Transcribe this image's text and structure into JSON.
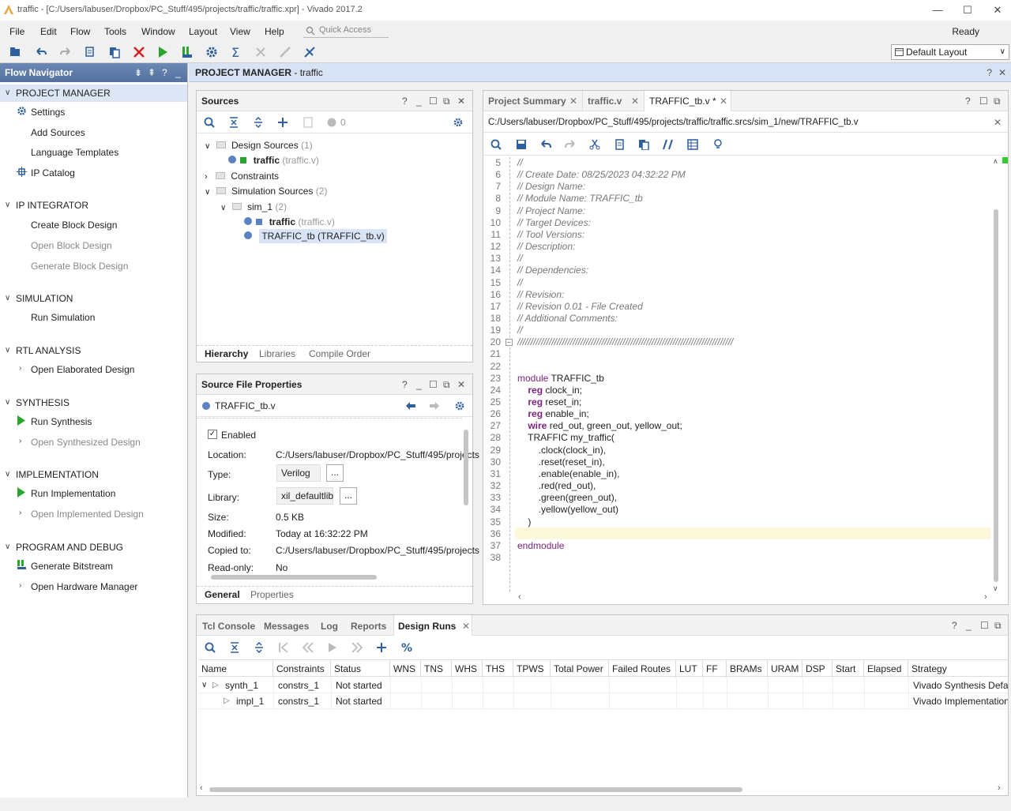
{
  "window": {
    "title": "traffic - [C:/Users/labuser/Dropbox/PC_Stuff/495/projects/traffic/traffic.xpr] - Vivado 2017.2",
    "status": "Ready"
  },
  "menu": {
    "items": [
      "File",
      "Edit",
      "Flow",
      "Tools",
      "Window",
      "Layout",
      "View",
      "Help"
    ],
    "quick_access_placeholder": "Quick Access"
  },
  "toolbar": {
    "layout_select": "Default Layout"
  },
  "flow_navigator": {
    "title": "Flow Navigator",
    "sections": [
      {
        "label": "PROJECT MANAGER",
        "items": [
          {
            "label": "Settings",
            "icon": "gear-icon"
          },
          {
            "label": "Add Sources"
          },
          {
            "label": "Language Templates"
          },
          {
            "label": "IP Catalog",
            "icon": "ip-catalog-icon"
          }
        ]
      },
      {
        "label": "IP INTEGRATOR",
        "items": [
          {
            "label": "Create Block Design"
          },
          {
            "label": "Open Block Design",
            "dim": true
          },
          {
            "label": "Generate Block Design",
            "dim": true
          }
        ]
      },
      {
        "label": "SIMULATION",
        "items": [
          {
            "label": "Run Simulation"
          }
        ]
      },
      {
        "label": "RTL ANALYSIS",
        "items": [
          {
            "label": "Open Elaborated Design"
          }
        ]
      },
      {
        "label": "SYNTHESIS",
        "items": [
          {
            "label": "Run Synthesis"
          },
          {
            "label": "Open Synthesized Design",
            "dim": true
          }
        ]
      },
      {
        "label": "IMPLEMENTATION",
        "items": [
          {
            "label": "Run Implementation"
          },
          {
            "label": "Open Implemented Design",
            "dim": true
          }
        ]
      },
      {
        "label": "PROGRAM AND DEBUG",
        "items": [
          {
            "label": "Generate Bitstream"
          },
          {
            "label": "Open Hardware Manager"
          }
        ]
      }
    ]
  },
  "project_manager": {
    "title": "PROJECT MANAGER",
    "project": "- traffic"
  },
  "sources": {
    "title": "Sources",
    "badge": "0",
    "tree": [
      {
        "label": "Design Sources",
        "count": "(1)"
      },
      {
        "label": "traffic",
        "extra": "(traffic.v)"
      },
      {
        "label": "Constraints"
      },
      {
        "label": "Simulation Sources",
        "count": "(2)"
      },
      {
        "label": "sim_1",
        "count": "(2)"
      },
      {
        "label": "traffic",
        "extra": "(traffic.v)"
      },
      {
        "label": "TRAFFIC_tb (TRAFFIC_tb.v)"
      }
    ],
    "tabs": [
      "Hierarchy",
      "Libraries",
      "Compile Order"
    ]
  },
  "file_props": {
    "title": "Source File Properties",
    "file": "TRAFFIC_tb.v",
    "enabled_label": "Enabled",
    "rows": [
      {
        "label": "Location:",
        "value": "C:/Users/labuser/Dropbox/PC_Stuff/495/projects"
      },
      {
        "label": "Type:",
        "value": "Verilog"
      },
      {
        "label": "Library:",
        "value": "xil_defaultlib"
      },
      {
        "label": "Size:",
        "value": "0.5 KB"
      },
      {
        "label": "Modified:",
        "value": "Today at 16:32:22 PM"
      },
      {
        "label": "Copied to:",
        "value": "C:/Users/labuser/Dropbox/PC_Stuff/495/projects"
      },
      {
        "label": "Read-only:",
        "value": "No"
      }
    ],
    "ellipsis": "...",
    "tabs": [
      "General",
      "Properties"
    ]
  },
  "editor": {
    "tabs": [
      "Project Summary",
      "traffic.v",
      "TRAFFIC_tb.v *"
    ],
    "path": "C:/Users/labuser/Dropbox/PC_Stuff/495/projects/traffic/traffic.srcs/sim_1/new/TRAFFIC_tb.v",
    "lines": [
      {
        "n": "5",
        "t": "//"
      },
      {
        "n": "6",
        "t": "// Create Date: 08/25/2023 04:32:22 PM"
      },
      {
        "n": "7",
        "t": "// Design Name:"
      },
      {
        "n": "8",
        "t": "// Module Name: TRAFFIC_tb"
      },
      {
        "n": "9",
        "t": "// Project Name:"
      },
      {
        "n": "10",
        "t": "// Target Devices:"
      },
      {
        "n": "11",
        "t": "// Tool Versions:"
      },
      {
        "n": "12",
        "t": "// Description:"
      },
      {
        "n": "13",
        "t": "//"
      },
      {
        "n": "14",
        "t": "// Dependencies:"
      },
      {
        "n": "15",
        "t": "//"
      },
      {
        "n": "16",
        "t": "// Revision:"
      },
      {
        "n": "17",
        "t": "// Revision 0.01 - File Created"
      },
      {
        "n": "18",
        "t": "// Additional Comments:"
      },
      {
        "n": "19",
        "t": "//"
      },
      {
        "n": "20",
        "t": "//////////////////////////////////////////////////////////////////////////////////"
      },
      {
        "n": "21",
        "t": ""
      },
      {
        "n": "22",
        "t": ""
      },
      {
        "n": "23",
        "t": "module TRAFFIC_tb"
      },
      {
        "n": "24",
        "t": "    reg clock_in;"
      },
      {
        "n": "25",
        "t": "    reg reset_in;"
      },
      {
        "n": "26",
        "t": "    reg enable_in;"
      },
      {
        "n": "27",
        "t": "    wire red_out, green_out, yellow_out;"
      },
      {
        "n": "28",
        "t": "    TRAFFIC my_traffic("
      },
      {
        "n": "29",
        "t": "        .clock(clock_in),"
      },
      {
        "n": "30",
        "t": "        .reset(reset_in),"
      },
      {
        "n": "31",
        "t": "        .enable(enable_in),"
      },
      {
        "n": "32",
        "t": "        .red(red_out),"
      },
      {
        "n": "33",
        "t": "        .green(green_out),"
      },
      {
        "n": "34",
        "t": "        .yellow(yellow_out)"
      },
      {
        "n": "35",
        "t": "    )"
      },
      {
        "n": "36",
        "t": ""
      },
      {
        "n": "37",
        "t": "endmodule"
      },
      {
        "n": "38",
        "t": ""
      }
    ]
  },
  "bottom": {
    "tabs": [
      "Tcl Console",
      "Messages",
      "Log",
      "Reports",
      "Design Runs"
    ],
    "columns": [
      "Name",
      "Constraints",
      "Status",
      "WNS",
      "TNS",
      "WHS",
      "THS",
      "TPWS",
      "Total Power",
      "Failed Routes",
      "LUT",
      "FF",
      "BRAMs",
      "URAM",
      "DSP",
      "Start",
      "Elapsed",
      "Strategy"
    ],
    "runs": [
      {
        "name": "synth_1",
        "constraints": "constrs_1",
        "status": "Not started",
        "strategy": "Vivado Synthesis Defaul"
      },
      {
        "name": "impl_1",
        "constraints": "constrs_1",
        "status": "Not started",
        "strategy": "Vivado Implementation D"
      }
    ]
  }
}
